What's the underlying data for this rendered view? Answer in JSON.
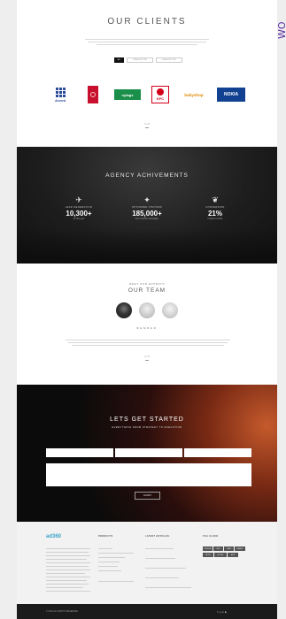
{
  "side_text": "WO",
  "clients": {
    "title": "OUR CLIENTS",
    "tabs": [
      "ALL",
      "CATEGORY ONE",
      "CATEGORY TWO"
    ],
    "logos": [
      {
        "name": "Accord",
        "text": "Accord",
        "color": "#2a4a9a",
        "icon": "grid-logo-icon"
      },
      {
        "name": "Emirates",
        "text": "",
        "color": "#c8102e",
        "icon": "emirates-logo-icon"
      },
      {
        "name": "Tags",
        "text": "nytags",
        "color": "#1a8f4a",
        "icon": "tags-logo-icon"
      },
      {
        "name": "KFC",
        "text": "KFC",
        "color": "#d4001a",
        "icon": "kfc-logo-icon"
      },
      {
        "name": "Babyshop",
        "text": "babyshop",
        "color": "#e08a00",
        "icon": "babyshop-logo-icon"
      },
      {
        "name": "Nokia",
        "text": "NOKIA",
        "color": "#124191",
        "icon": "nokia-logo-icon"
      }
    ],
    "pager": "1 / 3"
  },
  "achievements": {
    "title": "AGENCY ACHIVEMENTS",
    "stats": [
      {
        "icon": "rocket-icon",
        "label": "LEAD GENERATION",
        "value": "10,300+",
        "sub": "for this year"
      },
      {
        "icon": "megaphone-icon",
        "label": "OPTIMIZED VISITORS",
        "value": "185,000+",
        "sub": "last 3 months campaigns"
      },
      {
        "icon": "plant-icon",
        "label": "CONVERSION",
        "value": "21%",
        "sub": "in last 6 months"
      }
    ]
  },
  "team": {
    "kicker": "MEET OUR EXPERTS",
    "title": "OUR TEAM",
    "member_name": "MEMBER",
    "pager": "1 / 3"
  },
  "start": {
    "title": "LETS GET STARTED",
    "subtitle": "EVERYTHING FROM STRATEGY TO EXECUTION",
    "button": "SUBMIT"
  },
  "footer": {
    "logo": "ad360",
    "col_heads": [
      "PRODUCTS",
      "LATEST ARTICLES",
      "TAG CLOUD"
    ],
    "tags": [
      "DESIGN",
      "SEO",
      "WEB",
      "BRAND",
      "APPS",
      "SOCIAL",
      "ADS"
    ],
    "copyright": "© 2019 ALL RIGHTS RESERVED",
    "social": "f  t  g  in  ▶"
  }
}
